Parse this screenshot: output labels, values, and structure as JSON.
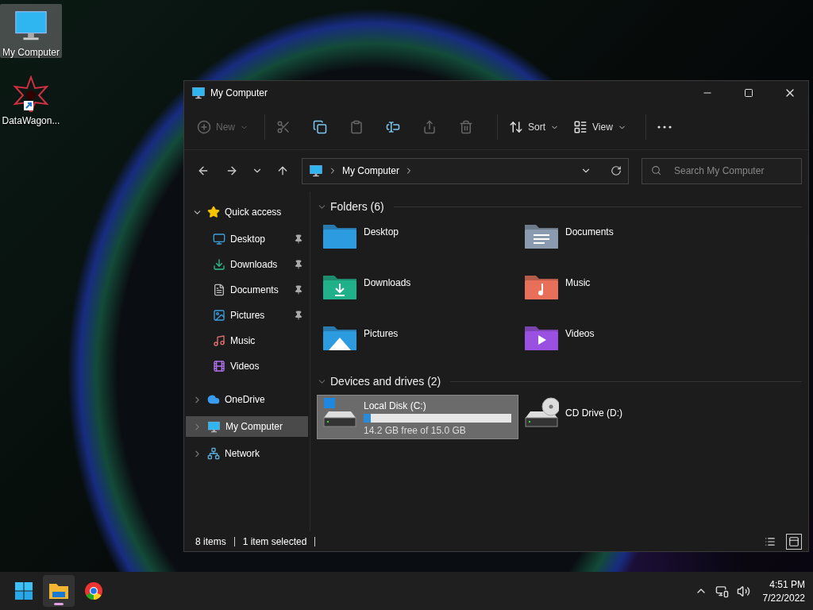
{
  "desktop_icons": [
    {
      "kind": "computer",
      "label": "My Computer",
      "selected": true
    },
    {
      "kind": "app",
      "label": "DataWagon...",
      "selected": false
    }
  ],
  "window": {
    "title": "My Computer",
    "toolbar": [
      {
        "kind": "new",
        "label": "New",
        "disabled": true
      },
      {
        "kind": "cut",
        "disabled": true
      },
      {
        "kind": "copy",
        "disabled": false
      },
      {
        "kind": "paste",
        "disabled": true
      },
      {
        "kind": "rename",
        "disabled": false
      },
      {
        "kind": "share",
        "disabled": true
      },
      {
        "kind": "delete",
        "disabled": true
      },
      {
        "kind": "sort",
        "label": "Sort",
        "disabled": false
      },
      {
        "kind": "view",
        "label": "View",
        "disabled": false
      },
      {
        "kind": "more",
        "disabled": false
      }
    ],
    "address": {
      "path": "My Computer"
    },
    "search": {
      "placeholder": "Search My Computer"
    },
    "sidebar": [
      {
        "kind": "star",
        "label": "Quick access",
        "expanded": true,
        "selected": false,
        "children": [
          {
            "kind": "desktop",
            "label": "Desktop",
            "pinned": true
          },
          {
            "kind": "downloads",
            "label": "Downloads",
            "pinned": true
          },
          {
            "kind": "documents",
            "label": "Documents",
            "pinned": true
          },
          {
            "kind": "pictures",
            "label": "Pictures",
            "pinned": true
          },
          {
            "kind": "music",
            "label": "Music",
            "pinned": false
          },
          {
            "kind": "videos",
            "label": "Videos",
            "pinned": false
          }
        ]
      },
      {
        "kind": "cloud",
        "label": "OneDrive",
        "expanded": false,
        "selected": false
      },
      {
        "kind": "computer",
        "label": "My Computer",
        "expanded": false,
        "selected": true
      },
      {
        "kind": "network",
        "label": "Network",
        "expanded": false,
        "selected": false
      }
    ],
    "sections": [
      {
        "title": "Folders (6)",
        "kind": "folders",
        "items": [
          {
            "kind": "desktop",
            "label": "Desktop"
          },
          {
            "kind": "documents",
            "label": "Documents"
          },
          {
            "kind": "downloads",
            "label": "Downloads"
          },
          {
            "kind": "music",
            "label": "Music"
          },
          {
            "kind": "pictures",
            "label": "Pictures"
          },
          {
            "kind": "videos",
            "label": "Videos"
          }
        ]
      },
      {
        "title": "Devices and drives (2)",
        "kind": "drives",
        "items": [
          {
            "kind": "disk",
            "label": "Local Disk (C:)",
            "free": "14.2 GB free of 15.0 GB",
            "level": 0.05,
            "selected": true
          },
          {
            "kind": "cd",
            "label": "CD Drive (D:)",
            "selected": false
          }
        ]
      }
    ],
    "status_bar": {
      "items": [
        "8 items",
        "1 item selected"
      ],
      "view_buttons": [
        {
          "kind": "details",
          "selected": false
        },
        {
          "kind": "tiles",
          "selected": true
        }
      ]
    }
  },
  "taskbar": {
    "apps": [
      {
        "kind": "start",
        "active": false
      },
      {
        "kind": "explorer",
        "active": true
      },
      {
        "kind": "chrome",
        "active": false
      }
    ],
    "time": "4:51 PM",
    "date": "7/22/2022"
  }
}
